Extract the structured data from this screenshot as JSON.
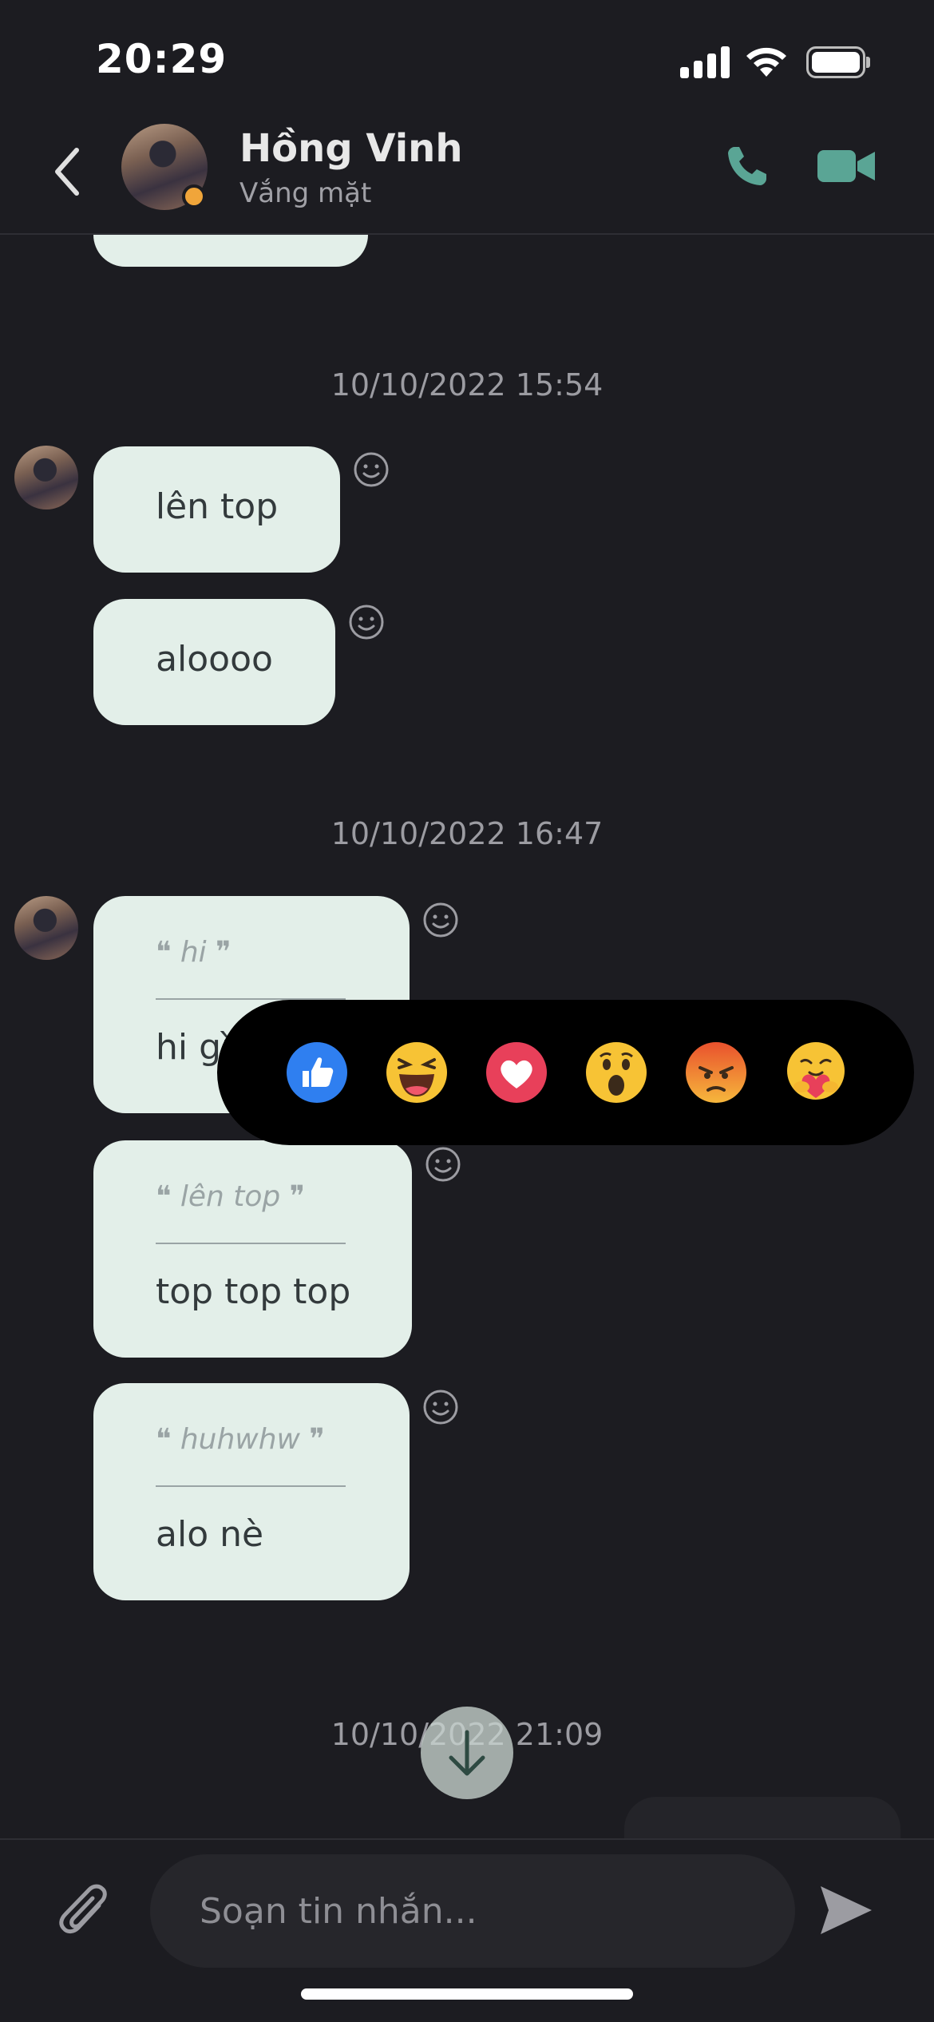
{
  "status_bar": {
    "time": "20:29"
  },
  "header": {
    "contact_name": "Hồng Vinh",
    "contact_status": "Vắng mặt",
    "presence_color": "#f0a53a",
    "accent_color": "#5aa595"
  },
  "messages": {
    "group1": {
      "timestamp": "10/10/2022 15:54",
      "msg1": "lên top",
      "msg2": "aloooo"
    },
    "group2": {
      "timestamp": "10/10/2022 16:47",
      "msg1": {
        "quote": "❝ hi ❞",
        "text": "hi gì"
      },
      "msg2": {
        "quote": "❝ lên top ❞",
        "text": "top top top"
      },
      "msg3": {
        "quote": "❝ huhwhw ❞",
        "text": "alo nè"
      }
    },
    "group3": {
      "timestamp": "10/10/2022 21:09"
    }
  },
  "reactions": [
    "like-icon",
    "haha-icon",
    "love-icon",
    "wow-icon",
    "angry-icon",
    "care-icon"
  ],
  "composer": {
    "placeholder": "Soạn tin nhắn..."
  },
  "bubble_color": "#e3efe9"
}
